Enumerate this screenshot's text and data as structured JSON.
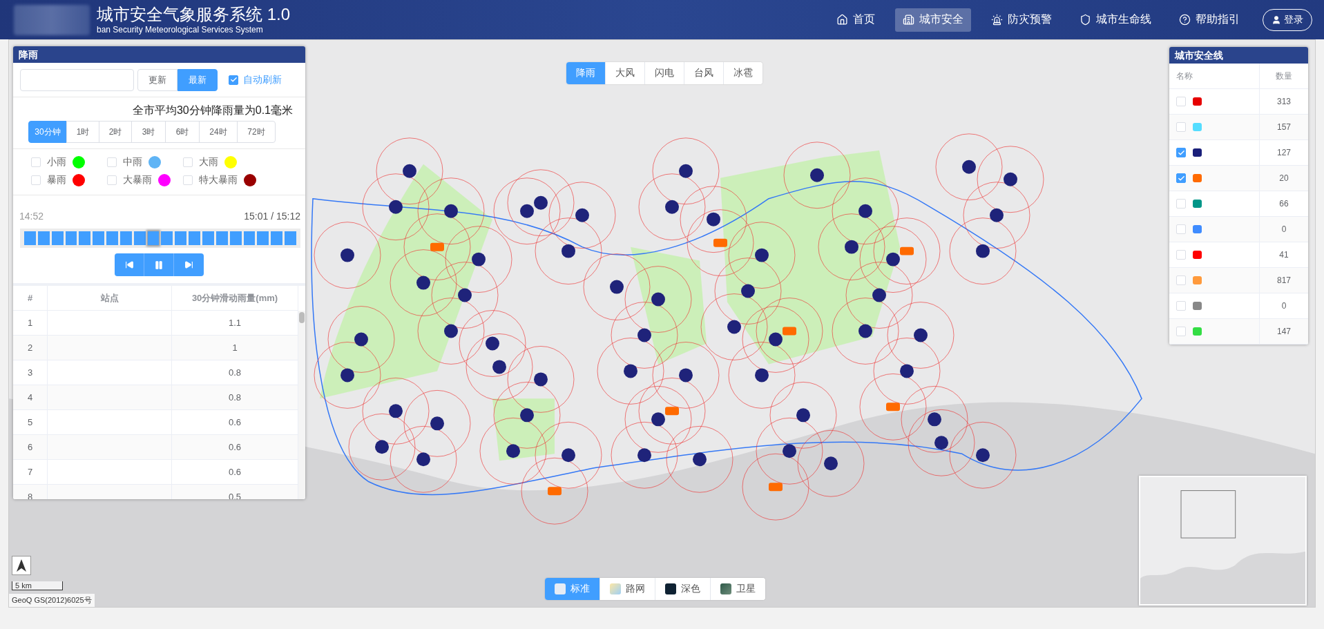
{
  "header": {
    "title": "城市安全气象服务系统 1.0",
    "subtitle": "ban Security Meteorological Services System",
    "nav": [
      {
        "label": "首页",
        "kind": "home",
        "selected": false
      },
      {
        "label": "城市安全",
        "kind": "building",
        "selected": true
      },
      {
        "label": "防灾预警",
        "kind": "alarm",
        "selected": false
      },
      {
        "label": "城市生命线",
        "kind": "shield",
        "selected": false
      },
      {
        "label": "帮助指引",
        "kind": "help",
        "selected": false
      }
    ],
    "login": "登录"
  },
  "hazard_tabs": [
    {
      "label": "降雨",
      "selected": true
    },
    {
      "label": "大风",
      "selected": false
    },
    {
      "label": "闪电",
      "selected": false
    },
    {
      "label": "台风",
      "selected": false
    },
    {
      "label": "冰雹",
      "selected": false
    }
  ],
  "rain_panel": {
    "title": "降雨",
    "refresh_buttons": [
      {
        "label": "更新",
        "selected": false
      },
      {
        "label": "最新",
        "selected": true
      }
    ],
    "auto_refresh": {
      "label": "自动刷新",
      "checked": true
    },
    "summary": "全市平均30分钟降雨量为0.1毫米",
    "period_tabs": [
      {
        "label": "30分钟",
        "selected": true
      },
      {
        "label": "1时",
        "selected": false
      },
      {
        "label": "2时",
        "selected": false
      },
      {
        "label": "3时",
        "selected": false
      },
      {
        "label": "6时",
        "selected": false
      },
      {
        "label": "24时",
        "selected": false
      },
      {
        "label": "72时",
        "selected": false
      }
    ],
    "legend": [
      {
        "label": "小雨",
        "color": "#00ff00",
        "checked": false
      },
      {
        "label": "中雨",
        "color": "#5fb4f5",
        "checked": false
      },
      {
        "label": "大雨",
        "color": "#ffff00",
        "checked": false
      },
      {
        "label": "暴雨",
        "color": "#ff0000",
        "checked": false
      },
      {
        "label": "大暴雨",
        "color": "#ff00ff",
        "checked": false
      },
      {
        "label": "特大暴雨",
        "color": "#990000",
        "checked": false
      }
    ],
    "time_start": "14:52",
    "time_current": "15:01 / 15:12",
    "timeline": [
      {
        "selected": false
      },
      {
        "selected": false
      },
      {
        "selected": false
      },
      {
        "selected": false
      },
      {
        "selected": false
      },
      {
        "selected": false
      },
      {
        "selected": false
      },
      {
        "selected": false
      },
      {
        "selected": false
      },
      {
        "selected": true
      },
      {
        "selected": false
      },
      {
        "selected": false
      },
      {
        "selected": false
      },
      {
        "selected": false
      },
      {
        "selected": false
      },
      {
        "selected": false
      },
      {
        "selected": false
      },
      {
        "selected": false
      },
      {
        "selected": false
      },
      {
        "selected": false
      }
    ],
    "table": {
      "columns": [
        "#",
        "站点",
        "30分钟滑动雨量(mm)"
      ],
      "rows": [
        {
          "index": "1",
          "value": "1.1"
        },
        {
          "index": "2",
          "value": "1"
        },
        {
          "index": "3",
          "value": "0.8"
        },
        {
          "index": "4",
          "value": "0.8"
        },
        {
          "index": "5",
          "value": "0.6"
        },
        {
          "index": "6",
          "value": "0.6"
        },
        {
          "index": "7",
          "value": "0.6"
        },
        {
          "index": "8",
          "value": "0.5"
        }
      ]
    }
  },
  "lifeline_panel": {
    "title": "城市安全线",
    "columns": [
      "名称",
      "数量"
    ],
    "rows": [
      {
        "checked": false,
        "color": "#e60000",
        "count": "313"
      },
      {
        "checked": false,
        "color": "#55ddff",
        "count": "157"
      },
      {
        "checked": true,
        "color": "#1a1f7a",
        "count": "127"
      },
      {
        "checked": true,
        "color": "#ff6a00",
        "count": "20"
      },
      {
        "checked": false,
        "color": "#009688",
        "count": "66"
      },
      {
        "checked": false,
        "color": "#3f8cff",
        "count": "0"
      },
      {
        "checked": false,
        "color": "#ff0000",
        "count": "41"
      },
      {
        "checked": false,
        "color": "#ff9a3c",
        "count": "817"
      },
      {
        "checked": false,
        "color": "#888888",
        "count": "0"
      },
      {
        "checked": false,
        "color": "#33dd44",
        "count": "147"
      }
    ]
  },
  "basemap_tabs": [
    {
      "label": "标准",
      "kind": "standard",
      "selected": true
    },
    {
      "label": "路网",
      "kind": "road",
      "selected": false
    },
    {
      "label": "深色",
      "kind": "dark",
      "selected": false
    },
    {
      "label": "卫星",
      "kind": "satellite",
      "selected": false
    }
  ],
  "map": {
    "scale": "5 km",
    "attribution": "GeoQ GS(2012)6025号"
  }
}
